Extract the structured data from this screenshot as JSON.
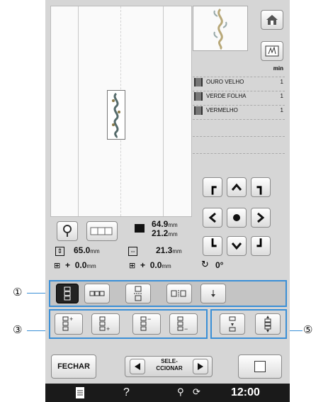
{
  "threads": {
    "header": "min",
    "items": [
      {
        "name": "OURO VELHO",
        "count": "1"
      },
      {
        "name": "VERDE FOLHA",
        "count": "1"
      },
      {
        "name": "VERMELHO",
        "count": "1"
      }
    ]
  },
  "size": {
    "width": "64.9",
    "height": "21.2",
    "unit": "mm"
  },
  "position": {
    "v_value": "65.0",
    "h_value": "21.3",
    "unit": "mm"
  },
  "offset": {
    "x_sign": "+",
    "x_value": "0.0",
    "y_sign": "+",
    "y_value": "0.0",
    "unit": "mm",
    "angle": "0°"
  },
  "callouts": {
    "c1": "①",
    "c3": "③",
    "c5": "⑤"
  },
  "bottom": {
    "close_label": "FECHAR",
    "select_label_line1": "SELE-",
    "select_label_line2": "CCIONAR"
  },
  "status_bar": {
    "help": "?",
    "time": "12:00"
  },
  "colors": {
    "highlight": "#3a8fd6",
    "status_bg": "#1a1a1a"
  }
}
